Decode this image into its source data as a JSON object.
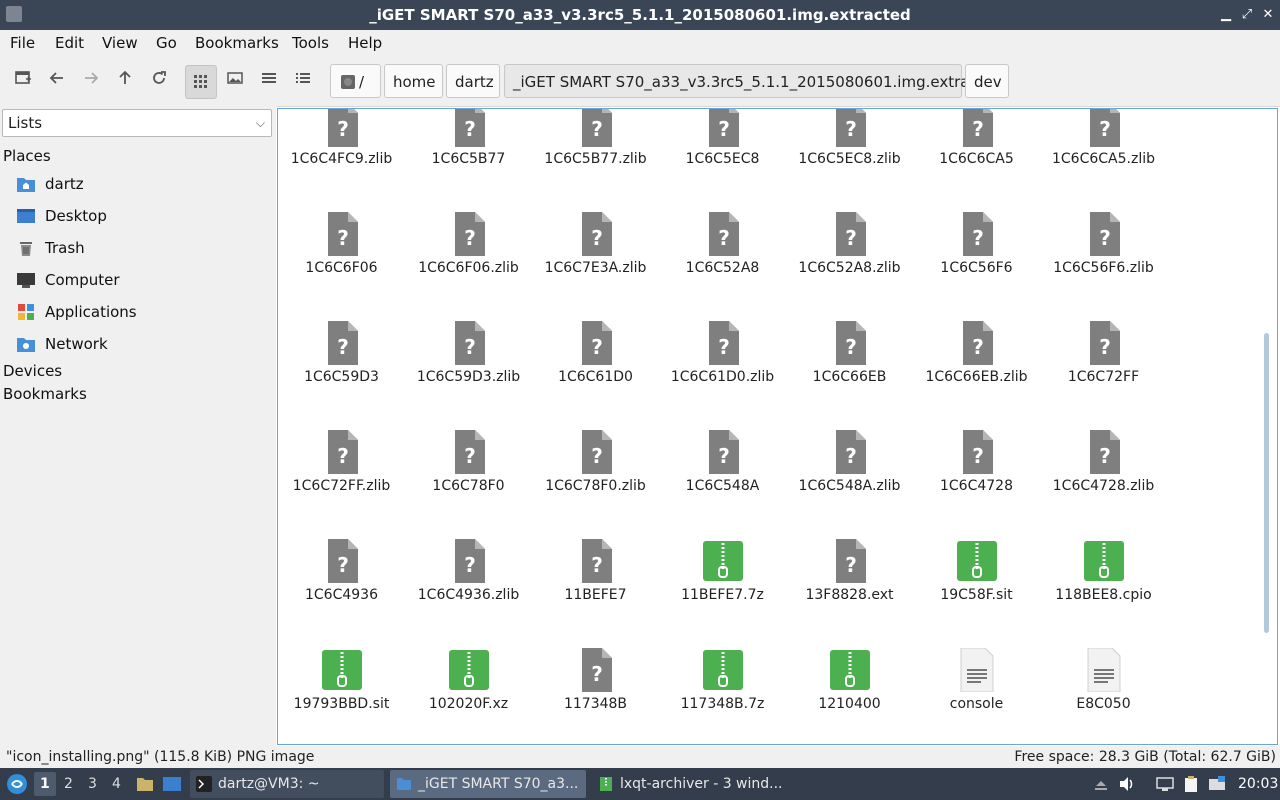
{
  "window": {
    "title": "_iGET SMART S70_a33_v3.3rc5_5.1.1_2015080601.img.extracted",
    "min": "▁",
    "max": "⤢",
    "close": "✕"
  },
  "menu": [
    "File",
    "Edit",
    "View",
    "Go",
    "Bookmarks",
    "Tools",
    "Help"
  ],
  "breadcrumbs": [
    "/",
    "home",
    "dartz",
    "_iGET SMART S70_a33_v3.3rc5_5.1.1_2015080601.img.extracted",
    "dev"
  ],
  "sidebar": {
    "mode": "Lists",
    "places_header": "Places",
    "places": [
      {
        "label": "dartz",
        "icon": "home-folder-icon"
      },
      {
        "label": "Desktop",
        "icon": "desktop-icon"
      },
      {
        "label": "Trash",
        "icon": "trash-icon"
      },
      {
        "label": "Computer",
        "icon": "computer-icon"
      },
      {
        "label": "Applications",
        "icon": "applications-icon"
      },
      {
        "label": "Network",
        "icon": "network-folder-icon"
      }
    ],
    "devices_header": "Devices",
    "bookmarks_header": "Bookmarks"
  },
  "files": [
    {
      "name": "1C6C4FC9.zlib",
      "type": "unknown"
    },
    {
      "name": "1C6C5B77",
      "type": "unknown"
    },
    {
      "name": "1C6C5B77.zlib",
      "type": "unknown"
    },
    {
      "name": "1C6C5EC8",
      "type": "unknown"
    },
    {
      "name": "1C6C5EC8.zlib",
      "type": "unknown"
    },
    {
      "name": "1C6C6CA5",
      "type": "unknown"
    },
    {
      "name": "1C6C6CA5.zlib",
      "type": "unknown"
    },
    {
      "name": "1C6C6F06",
      "type": "unknown"
    },
    {
      "name": "1C6C6F06.zlib",
      "type": "unknown"
    },
    {
      "name": "1C6C7E3A.zlib",
      "type": "unknown"
    },
    {
      "name": "1C6C52A8",
      "type": "unknown"
    },
    {
      "name": "1C6C52A8.zlib",
      "type": "unknown"
    },
    {
      "name": "1C6C56F6",
      "type": "unknown"
    },
    {
      "name": "1C6C56F6.zlib",
      "type": "unknown"
    },
    {
      "name": "1C6C59D3",
      "type": "unknown"
    },
    {
      "name": "1C6C59D3.zlib",
      "type": "unknown"
    },
    {
      "name": "1C6C61D0",
      "type": "unknown"
    },
    {
      "name": "1C6C61D0.zlib",
      "type": "unknown"
    },
    {
      "name": "1C6C66EB",
      "type": "unknown"
    },
    {
      "name": "1C6C66EB.zlib",
      "type": "unknown"
    },
    {
      "name": "1C6C72FF",
      "type": "unknown"
    },
    {
      "name": "1C6C72FF.zlib",
      "type": "unknown"
    },
    {
      "name": "1C6C78F0",
      "type": "unknown"
    },
    {
      "name": "1C6C78F0.zlib",
      "type": "unknown"
    },
    {
      "name": "1C6C548A",
      "type": "unknown"
    },
    {
      "name": "1C6C548A.zlib",
      "type": "unknown"
    },
    {
      "name": "1C6C4728",
      "type": "unknown"
    },
    {
      "name": "1C6C4728.zlib",
      "type": "unknown"
    },
    {
      "name": "1C6C4936",
      "type": "unknown"
    },
    {
      "name": "1C6C4936.zlib",
      "type": "unknown"
    },
    {
      "name": "11BEFE7",
      "type": "unknown"
    },
    {
      "name": "11BEFE7.7z",
      "type": "archive"
    },
    {
      "name": "13F8828.ext",
      "type": "unknown"
    },
    {
      "name": "19C58F.sit",
      "type": "archive"
    },
    {
      "name": "118BEE8.cpio",
      "type": "archive"
    },
    {
      "name": "19793BBD.sit",
      "type": "archive"
    },
    {
      "name": "102020F.xz",
      "type": "archive"
    },
    {
      "name": "117348B",
      "type": "unknown"
    },
    {
      "name": "117348B.7z",
      "type": "archive"
    },
    {
      "name": "1210400",
      "type": "archive"
    },
    {
      "name": "console",
      "type": "text"
    },
    {
      "name": "E8C050",
      "type": "text"
    }
  ],
  "status": {
    "left": "\"icon_installing.png\" (115.8 KiB) PNG image",
    "right": "Free space: 28.3 GiB (Total: 62.7 GiB)"
  },
  "taskbar": {
    "desktops": [
      "1",
      "2",
      "3",
      "4"
    ],
    "tasks": [
      "dartz@VM3: ~",
      "_iGET SMART S70_a3...",
      "lxqt-archiver - 3 wind..."
    ],
    "clock": "20:03"
  },
  "colors": {
    "titlebar": "#3a4656",
    "taskbar": "#333d4c",
    "archive_green": "#4caf50",
    "unknown_gray": "#7f7f7f",
    "selection_border": "#6aa5d9"
  }
}
